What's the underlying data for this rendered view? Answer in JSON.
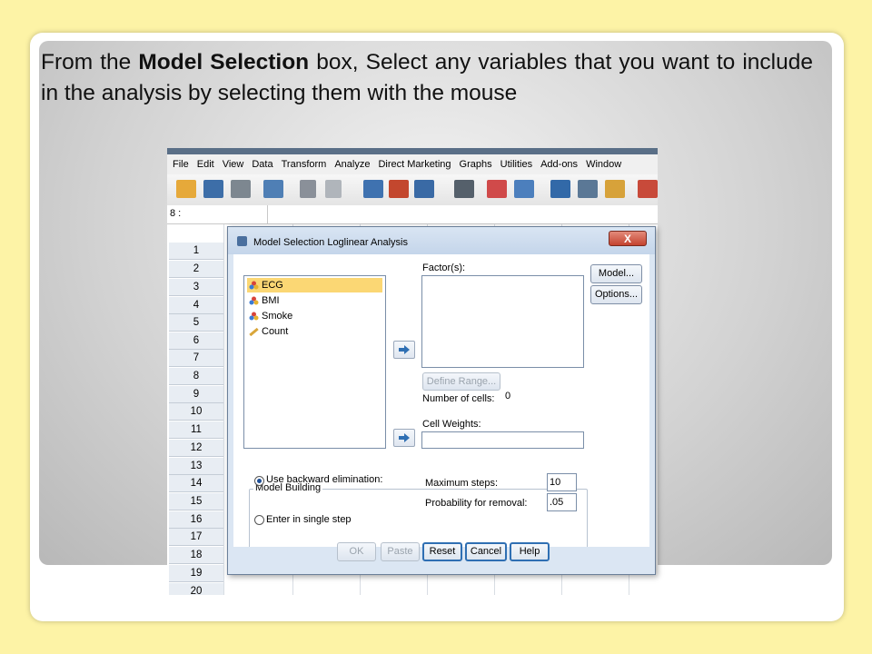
{
  "caption": {
    "part1": "From the ",
    "bold": "Model Selection",
    "part2": " box, Select any variables that you want to include in the analysis by selecting them with the mouse"
  },
  "menu": [
    "File",
    "Edit",
    "View",
    "Data",
    "Transform",
    "Analyze",
    "Direct Marketing",
    "Graphs",
    "Utilities",
    "Add-ons",
    "Window"
  ],
  "cell_ref": "8 :",
  "rows": [
    "1",
    "2",
    "3",
    "4",
    "5",
    "6",
    "7",
    "8",
    "9",
    "10",
    "11",
    "12",
    "13",
    "14",
    "15",
    "16",
    "17",
    "18",
    "19",
    "20"
  ],
  "dialog": {
    "title": "Model Selection Loglinear Analysis",
    "close_label": "X",
    "variables": [
      "ECG",
      "BMI",
      "Smoke",
      "Count"
    ],
    "selected_variable": "ECG",
    "factors_label": "Factor(s):",
    "define_range_label": "Define Range...",
    "num_cells_label": "Number of cells:",
    "num_cells_value": "0",
    "cell_weights_label": "Cell Weights:",
    "model_button": "Model...",
    "options_button": "Options...",
    "model_building_label": "Model Building",
    "backward_label": "Use backward elimination:",
    "single_step_label": "Enter in single step",
    "max_steps_label": "Maximum steps:",
    "max_steps_value": "10",
    "prob_removal_label": "Probability for removal:",
    "prob_removal_value": ".05",
    "buttons": {
      "ok": "OK",
      "paste": "Paste",
      "reset": "Reset",
      "cancel": "Cancel",
      "help": "Help"
    }
  },
  "colors": {
    "selection": "#fbd774",
    "accent": "#2f6fb3",
    "slide_background": "#fdf3a6"
  }
}
